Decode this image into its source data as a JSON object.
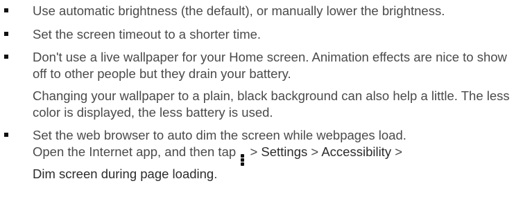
{
  "tips": [
    {
      "text": "Use automatic brightness (the default), or manually lower the brightness."
    },
    {
      "text": "Set the screen timeout to a shorter time."
    },
    {
      "text": "Don't use a live wallpaper for your Home screen. Animation effects are nice to show off to other people but they drain your battery."
    },
    {
      "text": "Set the web browser to auto dim the screen while webpages load."
    }
  ],
  "wallpaper_note": "Changing your wallpaper to a plain, black background can also help a little. The less color is displayed, the less battery is used.",
  "browser_steps": {
    "prefix": "Open the Internet app, and then tap",
    "menu_icon": "overflow-menu-icon",
    "separator": ">",
    "settings": "Settings",
    "accessibility": "Accessibility",
    "dim_option": "Dim screen during page loading",
    "end": "."
  }
}
